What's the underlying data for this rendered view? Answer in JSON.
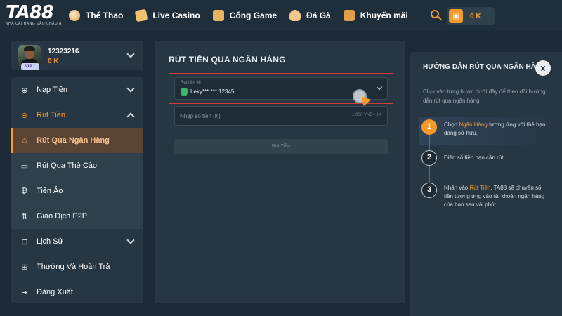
{
  "header": {
    "logo_text": "TA88",
    "logo_subtitle": "NHÀ CÁI HÀNG ĐẦU CHÂU Á",
    "nav": [
      {
        "label": "Thể Thao",
        "icon": "soccer-ball-icon"
      },
      {
        "label": "Live Casino",
        "icon": "playing-card-icon"
      },
      {
        "label": "Cổng Game",
        "icon": "slot-machine-icon"
      },
      {
        "label": "Đá Gà",
        "icon": "rooster-icon"
      },
      {
        "label": "Khuyến mãi",
        "icon": "gift-icon"
      }
    ],
    "wallet_balance": "0 K",
    "accent_color": "#f39a2b"
  },
  "user": {
    "id": "12323216",
    "balance": "0 K",
    "vip_badge": "VIP 1"
  },
  "sidebar": {
    "items": [
      {
        "label": "Nạp Tiền",
        "icon": "deposit-icon",
        "expandable": true
      },
      {
        "label": "Rút Tiền",
        "icon": "withdraw-icon",
        "expandable": true,
        "expanded": true
      },
      {
        "label": "Rút Qua Ngân Hàng",
        "icon": "bank-icon",
        "sub": true,
        "selected": true
      },
      {
        "label": "Rút Qua Thẻ Cào",
        "icon": "card-icon",
        "sub": true
      },
      {
        "label": "Tiền Ảo",
        "icon": "bitcoin-icon",
        "sub": true
      },
      {
        "label": "Giao Dịch P2P",
        "icon": "p2p-icon",
        "sub": true
      },
      {
        "label": "Lịch Sử",
        "icon": "history-icon",
        "expandable": true
      },
      {
        "label": "Thưởng Và Hoàn Trả",
        "icon": "reward-icon"
      },
      {
        "label": "Đăng Xuất",
        "icon": "logout-icon"
      }
    ]
  },
  "main": {
    "title": "RÚT TIỀN QUA NGÂN HÀNG",
    "bank_select": {
      "label": "Rút tiền về",
      "value": "Leky*** *** 12345"
    },
    "amount": {
      "placeholder": "Nhập số tiền (K)",
      "hint": "1,000 VNĐ= 1K"
    },
    "submit_label": "Rút Tiền"
  },
  "guide": {
    "title": "HƯỚNG DẪN RÚT QUA NGÂN HÀNG",
    "close_label": "×",
    "description": "Click vào từng bước dưới đây để theo dõi hướng dẫn rút qua ngân hàng",
    "steps": [
      {
        "num": "1",
        "pre": "Chọn ",
        "highlight": "Ngân Hàng",
        "post": " tương ứng với thẻ bạn đang sở hữu."
      },
      {
        "num": "2",
        "pre": "Điền số tiền bạn cần rút.",
        "highlight": "",
        "post": ""
      },
      {
        "num": "3",
        "pre": "Nhấn vào ",
        "highlight": "Rút Tiền",
        "post": ", TA88 sẽ chuyển số tiền tương ứng vào tài khoản ngân hàng của bạn sau vài phút."
      }
    ]
  }
}
